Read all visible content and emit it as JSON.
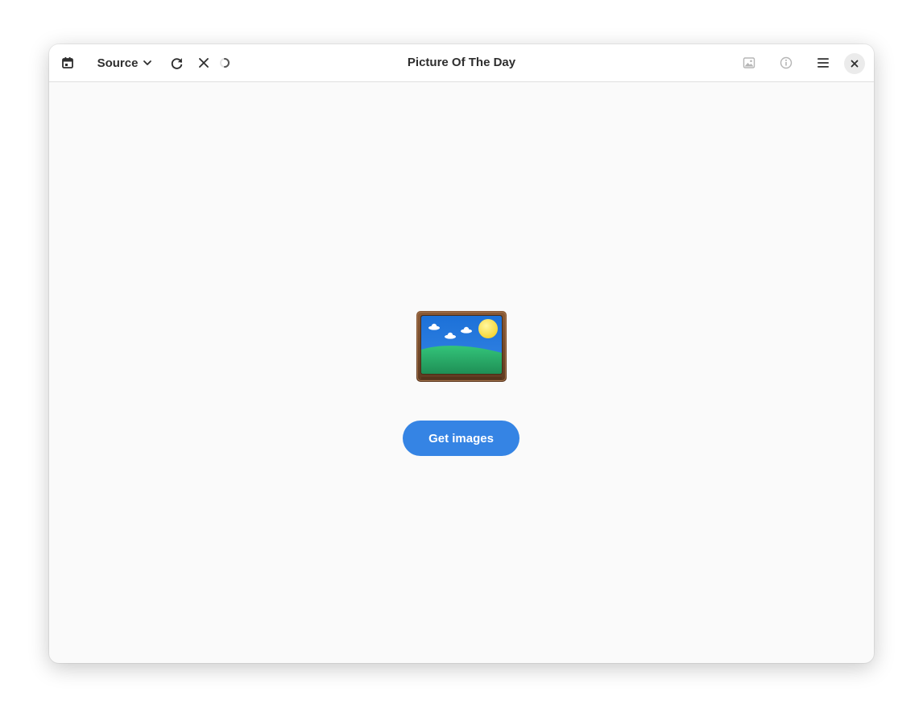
{
  "window": {
    "title": "Picture Of The Day"
  },
  "headerbar": {
    "calendar_icon": "calendar-icon",
    "source_label": "Source",
    "source_chevron_icon": "chevron-down-icon",
    "refresh_icon": "refresh-icon",
    "cancel_icon": "close-icon",
    "spinner_icon": "spinner-icon",
    "set_wallpaper_icon": "image-icon",
    "info_icon": "info-icon",
    "menu_icon": "hamburger-menu-icon",
    "window_close_icon": "window-close-icon"
  },
  "main": {
    "placeholder_icon": "framed-picture-icon",
    "get_images_label": "Get images"
  },
  "colors": {
    "accent": "#3584e4",
    "headerbar_bg": "#ffffff",
    "content_bg": "#fafafa",
    "disabled_icon": "#b5b5b5"
  }
}
